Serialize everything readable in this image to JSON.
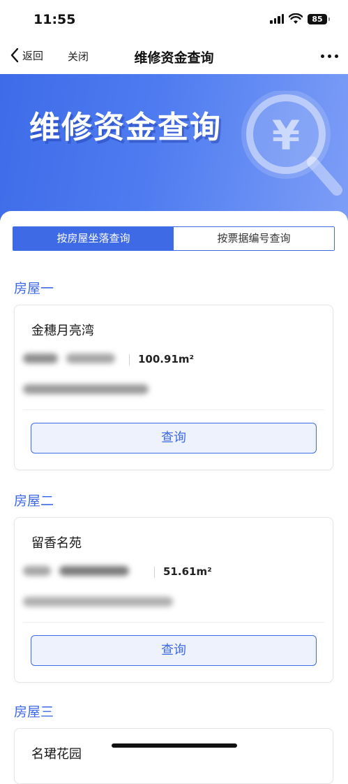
{
  "status_bar": {
    "time": "11:55",
    "battery": "85"
  },
  "nav": {
    "back_label": "返回",
    "close_label": "关闭",
    "title": "维修资金查询"
  },
  "banner": {
    "title": "维修资金查询",
    "icon_symbol": "¥"
  },
  "tabs": [
    {
      "label": "按房屋坐落查询",
      "active": true
    },
    {
      "label": "按票据编号查询",
      "active": false
    }
  ],
  "houses": [
    {
      "section": "房屋一",
      "name": "金穗月亮湾",
      "area": "100.91m²",
      "button": "查询"
    },
    {
      "section": "房屋二",
      "name": "留香名苑",
      "area": "51.61m²",
      "button": "查询"
    },
    {
      "section": "房屋三",
      "name": "名珺花园"
    }
  ],
  "colors": {
    "accent": "#3f6ae6",
    "banner_start": "#3e6ce9",
    "banner_end": "#7d9ef7"
  }
}
